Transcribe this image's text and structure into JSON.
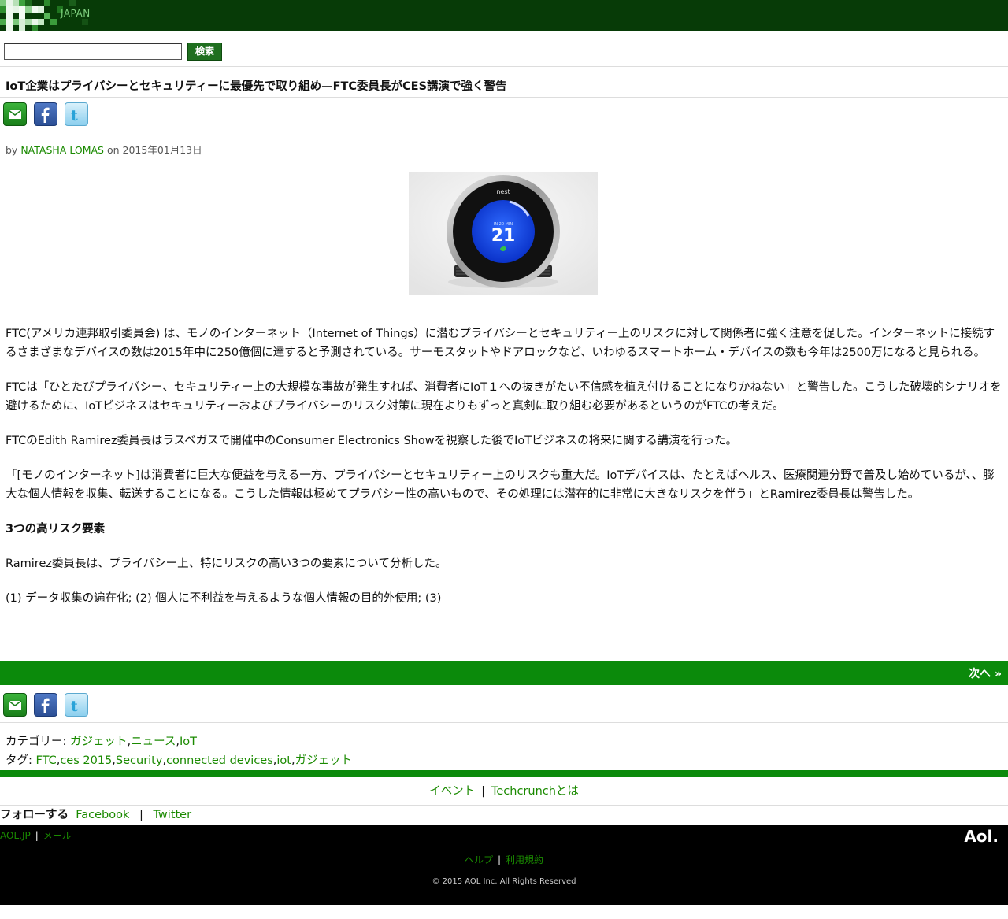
{
  "header": {
    "logo_text": "JAPAN",
    "logo_icon": "techcrunch-logo"
  },
  "search": {
    "input_value": "",
    "button_label": "検索"
  },
  "article": {
    "title": "IoT企業はプライバシーとセキュリティーに最優先で取り組め—FTC委員長がCES講演で強く警告",
    "byline_prefix": "by",
    "author": "NATASHA LOMAS",
    "date_prefix": "on",
    "date": "2015年01月13日",
    "image_alt": "nest thermostat",
    "image_text_brand": "nest",
    "image_text_number": "21",
    "image_text_small": "IN 20 MIN",
    "paragraphs": [
      "FTC(アメリカ連邦取引委員会) は、モノのインターネット（Internet of Things）に潜むプライバシーとセキュリティー上のリスクに対して関係者に強く注意を促した。インターネットに接続するさまざまなデバイスの数は2015年中に250億個に達すると予測されている。サーモスタットやドアロックなど、いわゆるスマートホーム・デバイスの数も今年は2500万になると見られる。",
      "FTCは「ひとたびプライバシー、セキュリティー上の大規模な事故が発生すれば、消費者にIoT１への抜きがたい不信感を植え付けることになりかねない」と警告した。こうした破壊的シナリオを避けるために、IoTビジネスはセキュリティーおよびプライバシーのリスク対策に現在よりもずっと真剣に取り組む必要があるというのがFTCの考えだ。",
      "FTCのEdith Ramirez委員長はラスベガスで開催中のConsumer Electronics Showを視察した後でIoTビジネスの将来に関する講演を行った。",
      "「[モノのインターネット]は消費者に巨大な便益を与える一方、プライバシーとセキュリティー上のリスクも重大だ。IoTデバイスは、たとえばヘルス、医療関連分野で普及し始めているが、、膨大な個人情報を収集、転送することになる。こうした情報は極めてプラバシー性の高いもので、その処理には潜在的に非常に大きなリスクを伴う」とRamirez委員長は警告した。"
    ],
    "subheading": "3つの高リスク要素",
    "paragraphs2": [
      "Ramirez委員長は、プライバシー上、特にリスクの高い3つの要素について分析した。",
      "(1) データ収集の遍在化; (2) 個人に不利益を与えるような個人情報の目的外使用; (3)"
    ]
  },
  "share": {
    "mail_icon": "mail-icon",
    "facebook_icon": "facebook-icon",
    "twitter_icon": "twitter-icon"
  },
  "pagination": {
    "next_label": "次へ »"
  },
  "taxonomy": {
    "category_label": "カテゴリー:",
    "categories": [
      "ガジェット",
      "ニュース",
      "IoT"
    ],
    "tag_label": "タグ:",
    "tags": [
      "FTC",
      "ces 2015",
      "Security",
      "connected devices",
      "iot",
      "ガジェット"
    ]
  },
  "links": {
    "events": "イベント",
    "about": "Techcrunchとは"
  },
  "follow": {
    "label": "フォローする",
    "facebook": "Facebook",
    "twitter": "Twitter"
  },
  "footer": {
    "aoljp": "AOL.JP",
    "mail": "メール",
    "aol_logo": "Aol.",
    "help": "ヘルプ",
    "terms": "利用規約",
    "copyright": "© 2015 AOL Inc. All Rights Reserved"
  },
  "colors": {
    "brand_green": "#0b8a0b",
    "header_dark": "#073b07",
    "link_green": "#1a8a00"
  }
}
